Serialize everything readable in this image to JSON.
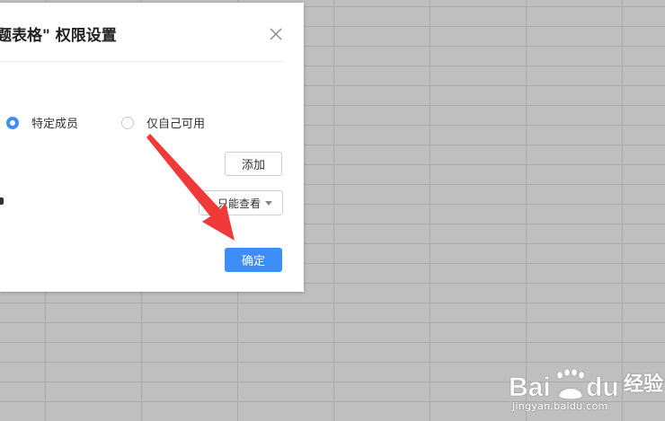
{
  "dialog": {
    "title": "题表格\" 权限设置",
    "close_icon": "close-icon",
    "radio_options": [
      {
        "label": "特定成员",
        "selected": true
      },
      {
        "label": "仅自己可用",
        "selected": false
      }
    ],
    "add_button_label": "添加",
    "permission_select_value": "只能查看",
    "confirm_button_label": "确定"
  },
  "colors": {
    "accent": "#3d8ef8",
    "annotation_arrow": "#f03a3a",
    "sheet_background": "#bfbfbf"
  },
  "watermark": {
    "logo_text": "Bai du",
    "brand_text": "经验",
    "url": "jingyan.baidu.com"
  }
}
